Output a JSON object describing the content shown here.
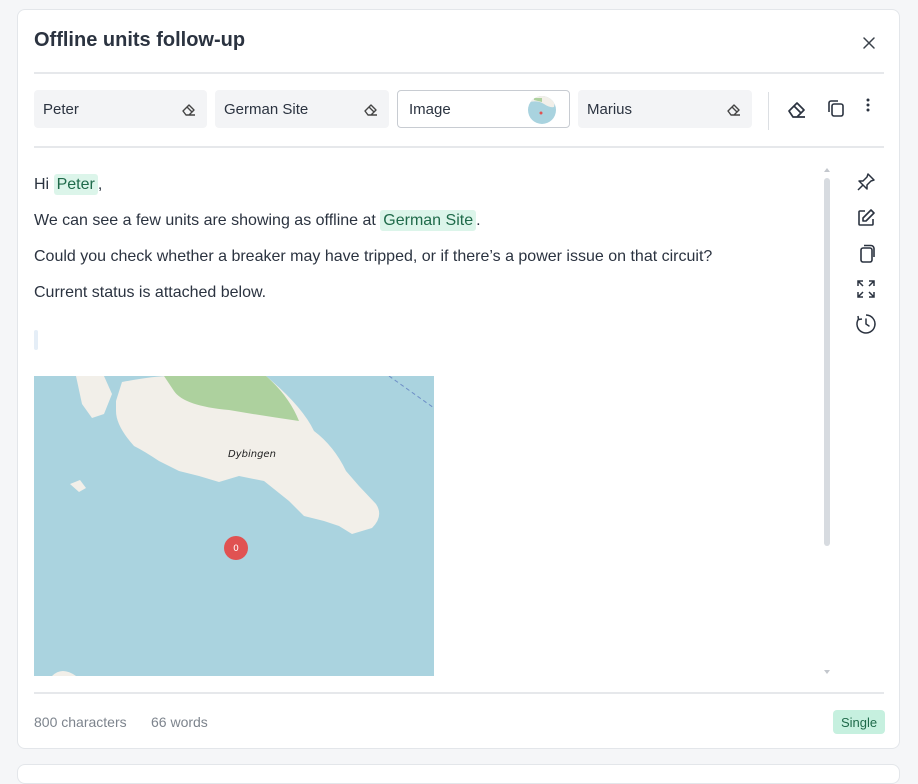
{
  "dialog": {
    "title": "Offline units follow-up"
  },
  "chips": [
    {
      "label": "Peter"
    },
    {
      "label": "German Site"
    },
    {
      "label": "Image"
    },
    {
      "label": "Marius"
    }
  ],
  "toolbar_icons": [
    "eraser-icon",
    "copy-icon",
    "more-vertical-icon"
  ],
  "message": {
    "greeting_prefix": "Hi",
    "greeting_tag": "Peter",
    "greeting_suffix": ",",
    "line2_prefix": "We can see a few units are showing as offline at",
    "line2_tag": "German Site",
    "line2_suffix": ".",
    "line3": "Could you check whether a breaker may have tripped, or if there’s a power issue on that circuit?",
    "line4": "Current status is attached below."
  },
  "map": {
    "place_label": "Dybingen",
    "marker_count": "0"
  },
  "side_icons": [
    "pin-icon",
    "edit-icon",
    "duplicate-icon",
    "expand-icon",
    "history-icon"
  ],
  "footer": {
    "characters": "800 characters",
    "words": "66 words",
    "mode_badge": "Single"
  },
  "colors": {
    "tag_bg": "#dcf5ea",
    "badge_bg": "#c6f0df",
    "water": "#aad3df",
    "land": "#f2efe9",
    "forest": "#add19e",
    "marker": "#e05252"
  }
}
